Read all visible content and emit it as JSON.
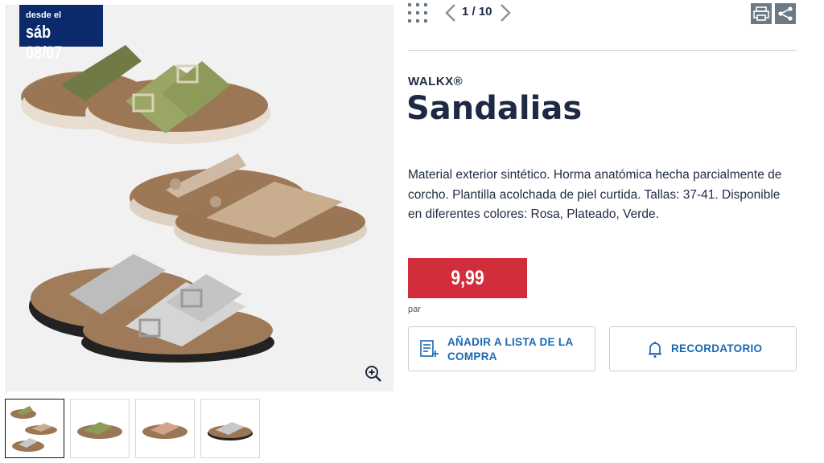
{
  "badge": {
    "line1": "desde el",
    "line2": "sáb 08/07"
  },
  "gallery": {
    "thumbnails": [
      "thumb-all-sandals",
      "thumb-green-sandal",
      "thumb-rose-sandal",
      "thumb-silver-sandal"
    ],
    "active_index": 0
  },
  "navigation": {
    "pager": "1 / 10"
  },
  "product": {
    "brand": "WALKX®",
    "title": "Sandalias",
    "description": "Material exterior sintético. Horma anatómica hecha parcialmente de corcho. Plantilla acolchada de piel curtida. Tallas: 37-41. Disponible en diferentes colores: Rosa, Plateado, Verde.",
    "price": "9,99",
    "unit": "par"
  },
  "actions": {
    "add_to_list": "AÑADIR A LISTA DE LA COMPRA",
    "reminder": "RECORDATORIO"
  },
  "colors": {
    "brand_navy": "#0b2a6b",
    "price_red": "#d12d3a",
    "link_blue": "#1a67b3"
  },
  "icons": [
    "grid-icon",
    "chevron-left-icon",
    "chevron-right-icon",
    "print-icon",
    "share-icon",
    "zoom-icon",
    "list-add-icon",
    "bell-icon"
  ]
}
